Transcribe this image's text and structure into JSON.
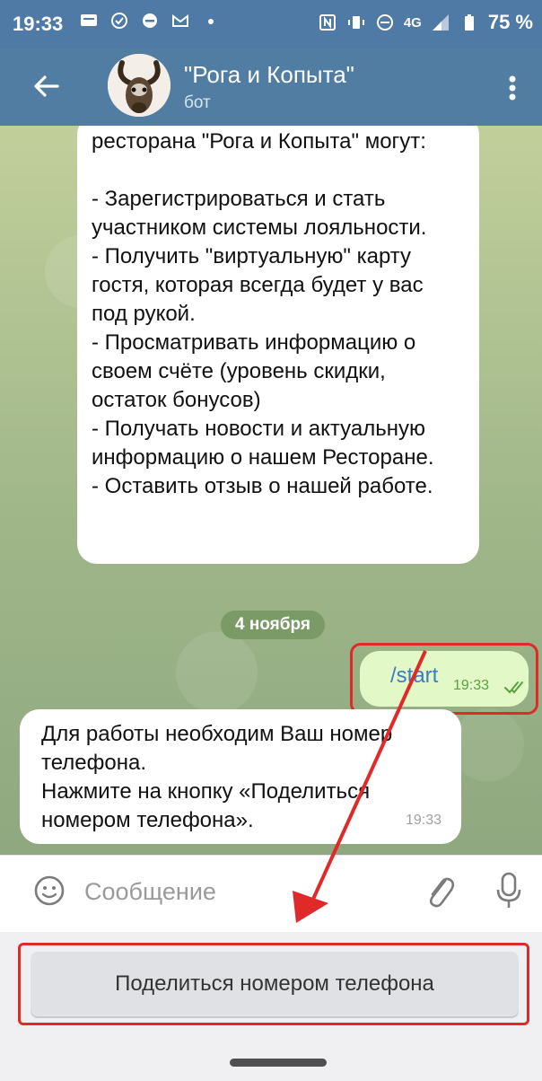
{
  "status_bar": {
    "time": "19:33",
    "network": "4G",
    "battery": "75 %"
  },
  "header": {
    "title": "\"Рога и Копыта\"",
    "subtitle": "бот"
  },
  "messages": {
    "bot_message_1": "ресторана \"Рога и Копыта\" могут:\n\n- Зарегистрироваться и стать участником системы лояльности.\n- Получить \"виртуальную\" карту гостя, которая всегда будет у вас под рукой.\n- Просматривать информацию о своем счёте (уровень скидки, остаток бонусов)\n- Получать новости и актуальную информацию о нашем Ресторане.\n- Оставить отзыв о нашей работе.",
    "date_separator": "4 ноября",
    "user_message": {
      "text": "/start",
      "time": "19:33"
    },
    "bot_message_2": {
      "text": "Для работы необходим Ваш номер телефона.\nНажмите на кнопку «Поделиться номером телефона».",
      "time": "19:33"
    }
  },
  "input": {
    "placeholder": "Сообщение"
  },
  "keyboard": {
    "share_phone_label": "Поделиться номером телефона"
  },
  "colors": {
    "header": "#527da3",
    "highlight": "#e02a2a",
    "outgoing_bubble": "#e2f8c7",
    "link_text": "#3d7bc4"
  },
  "icons": [
    "back-arrow-icon",
    "avatar",
    "menu-dots-icon",
    "double-check-icon",
    "emoji-icon",
    "paperclip-icon",
    "microphone-icon"
  ]
}
